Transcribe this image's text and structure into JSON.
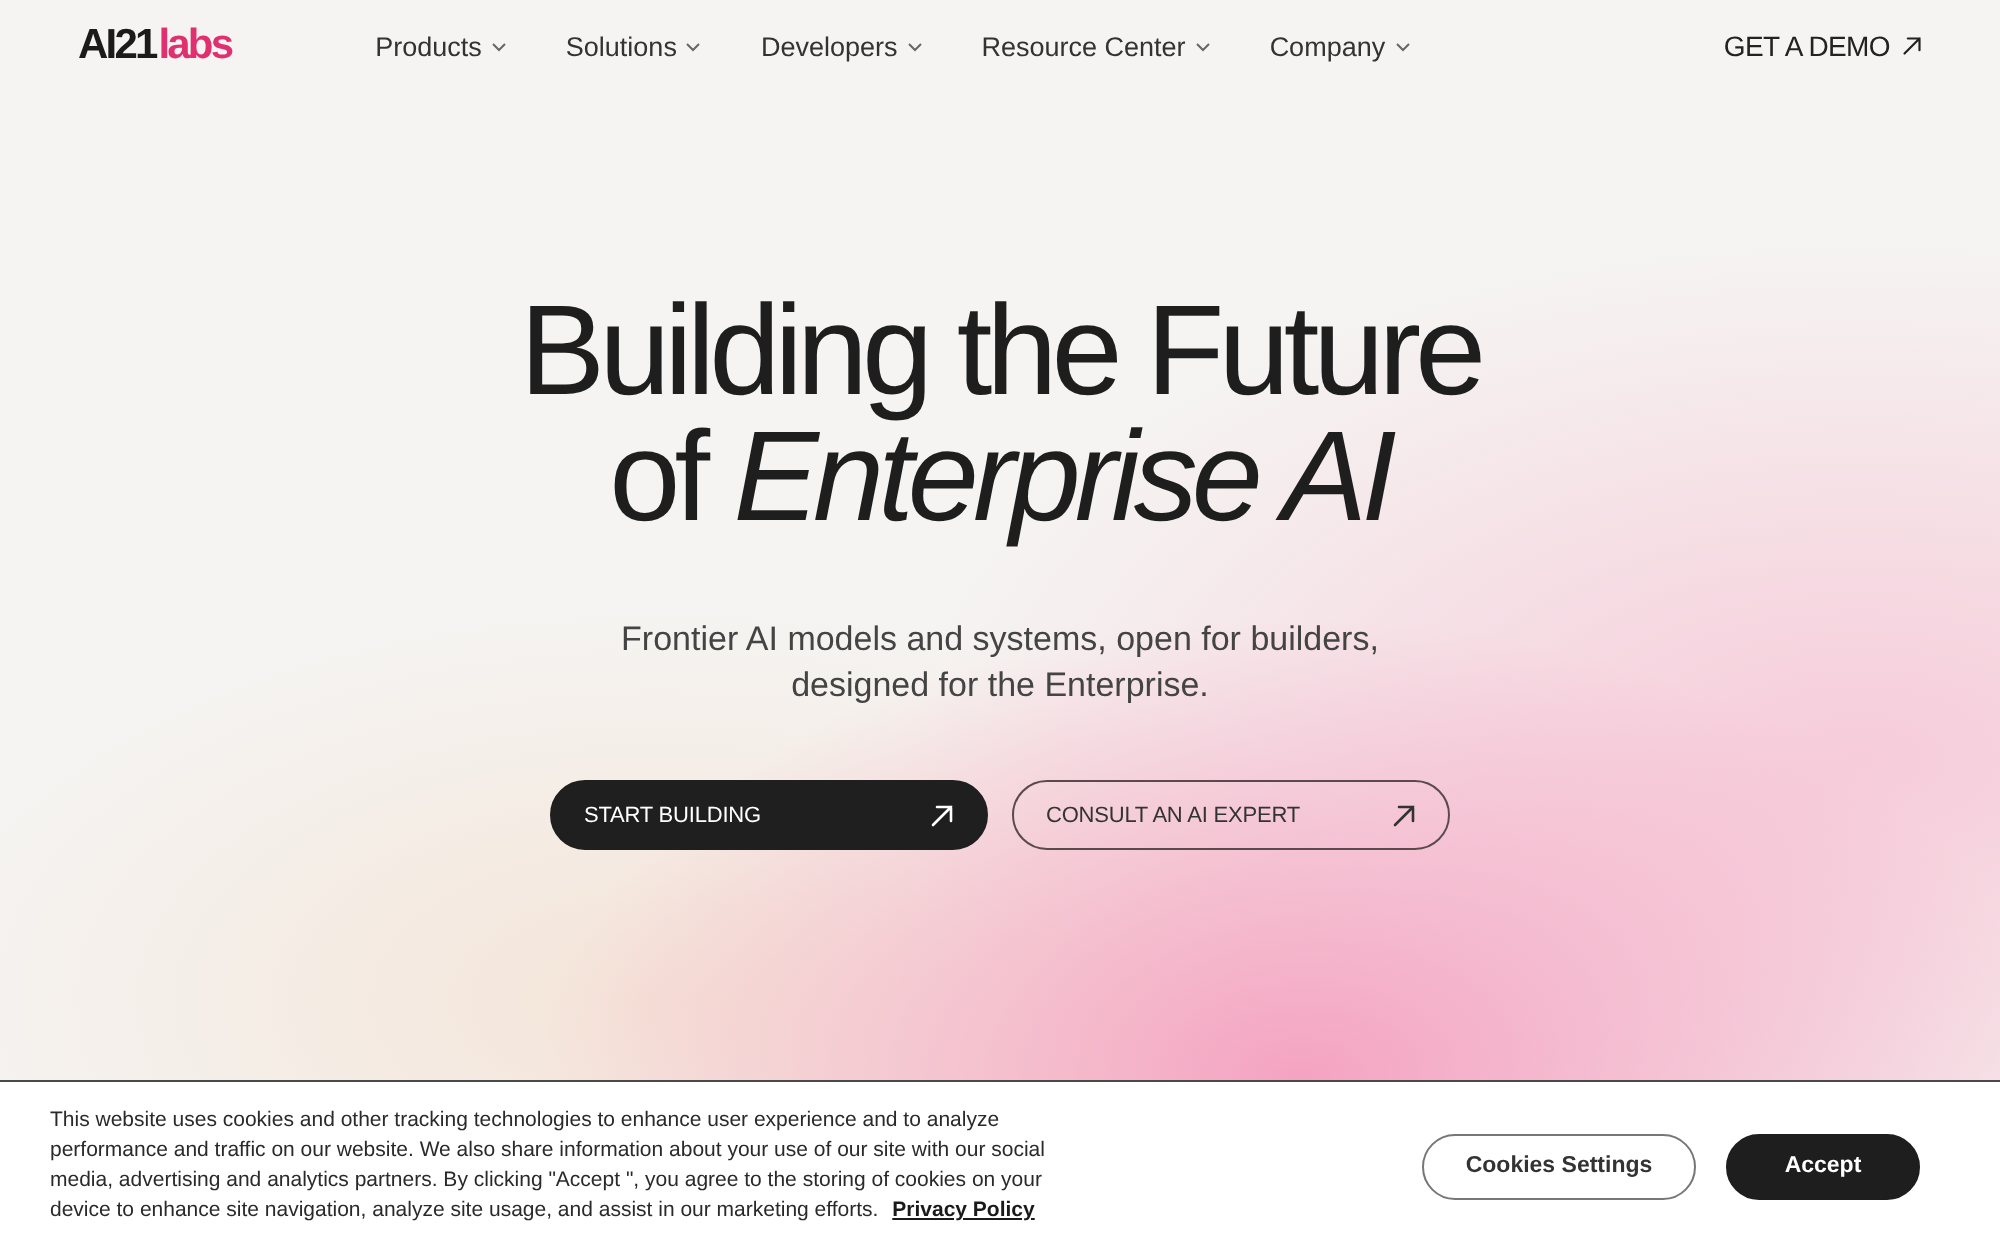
{
  "header": {
    "logo": {
      "mark": "AI21",
      "suffix": "labs"
    },
    "nav": [
      {
        "label": "Products"
      },
      {
        "label": "Solutions"
      },
      {
        "label": "Developers"
      },
      {
        "label": "Resource Center"
      },
      {
        "label": "Company"
      }
    ],
    "cta": {
      "label": "GET A DEMO"
    }
  },
  "hero": {
    "headline": [
      "Building the Future",
      "of *Enterprise AI*"
    ],
    "subtitle": [
      "Frontier AI models and systems, open for builders,",
      "designed for the Enterprise."
    ],
    "buttons": [
      {
        "label": "START BUILDING",
        "kind": "primary"
      },
      {
        "label": "CONSULT AN AI EXPERT",
        "kind": "outline"
      }
    ]
  },
  "cookie_banner": {
    "text": "This website uses cookies and other tracking technologies to enhance user experience and to analyze performance and traffic on our website. We also share information about your use of our site with our social media, advertising and analytics partners. By clicking \"Accept \", you agree to the storing of cookies on your device to enhance site navigation, analyze site usage, and assist in our marketing efforts.",
    "link": "Privacy Policy",
    "buttons": [
      {
        "label": "Cookies Settings",
        "kind": "outline"
      },
      {
        "label": "Accept",
        "kind": "primary"
      }
    ]
  }
}
